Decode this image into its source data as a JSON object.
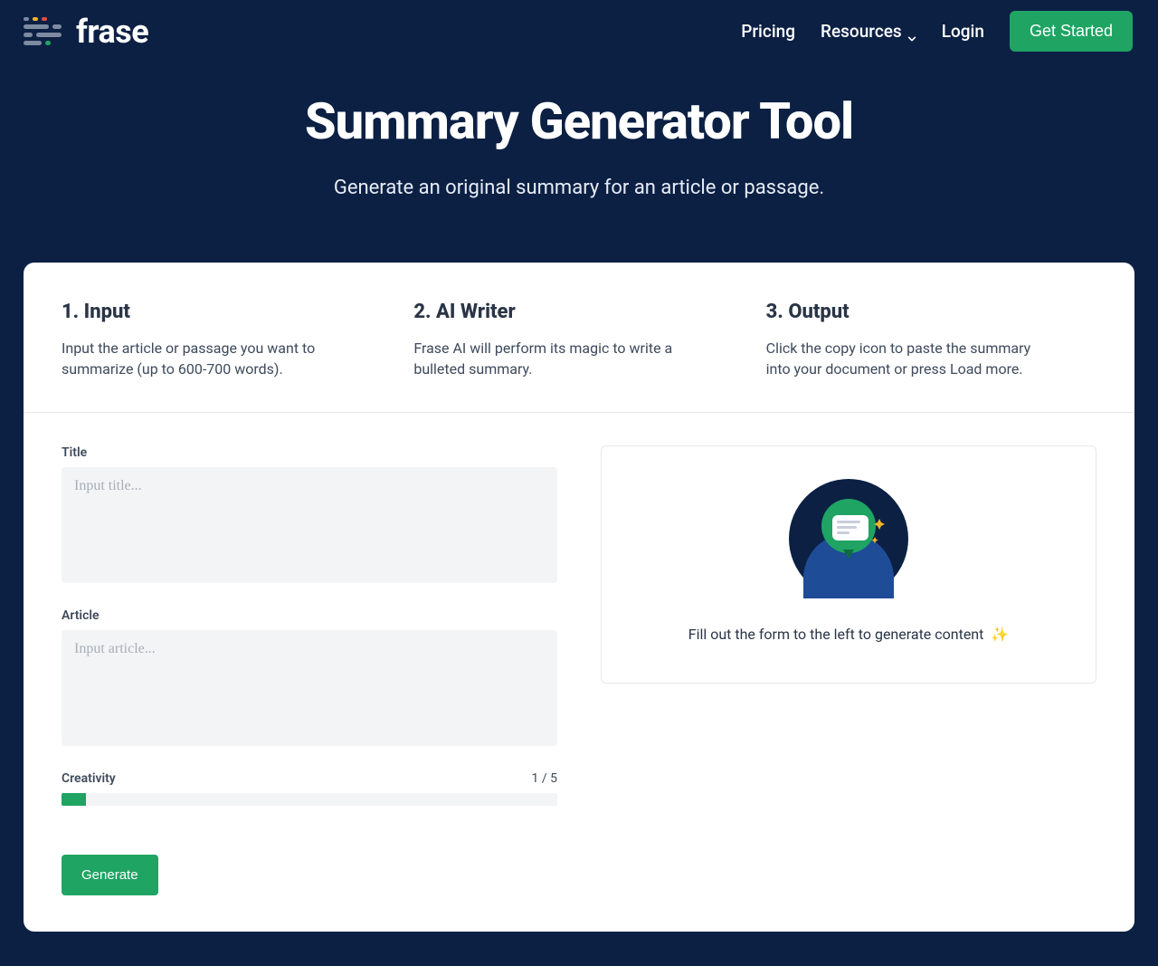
{
  "brand": "frase",
  "nav": {
    "pricing": "Pricing",
    "resources": "Resources",
    "login": "Login",
    "get_started": "Get Started"
  },
  "hero": {
    "title": "Summary Generator Tool",
    "subtitle": "Generate an original summary for an article or passage."
  },
  "steps": [
    {
      "title": "1. Input",
      "desc": "Input the article or passage you want to summarize (up to 600-700 words)."
    },
    {
      "title": "2. AI Writer",
      "desc": "Frase AI will perform its magic to write a bulleted summary."
    },
    {
      "title": "3. Output",
      "desc": "Click the copy icon to paste the summary into your document or press Load more."
    }
  ],
  "form": {
    "title_label": "Title",
    "title_placeholder": "Input title...",
    "article_label": "Article",
    "article_placeholder": "Input article...",
    "creativity_label": "Creativity",
    "creativity_value": "1 / 5",
    "generate_label": "Generate"
  },
  "output": {
    "prompt": "Fill out the form to the left to generate content",
    "sparkle": "✨"
  },
  "colors": {
    "bg": "#0c2044",
    "accent": "#1fa463"
  }
}
